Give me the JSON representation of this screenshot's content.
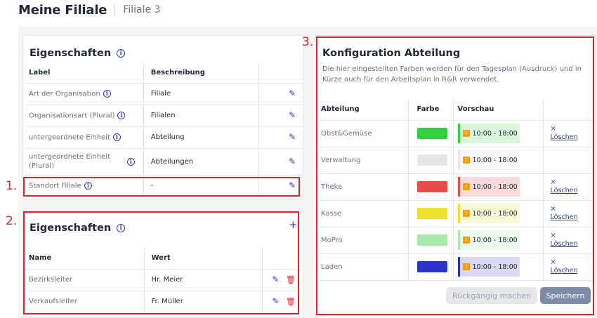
{
  "header": {
    "title": "Meine Filiale",
    "subtitle": "Filiale 3"
  },
  "annotations": {
    "label1": "1.",
    "label2": "2.",
    "label3": "3."
  },
  "properties": {
    "title": "Eigenschaften",
    "col_label": "Label",
    "col_desc": "Beschreibung",
    "rows": [
      {
        "label": "Art der Organisation",
        "value": "Filiale"
      },
      {
        "label": "Organisationsart (Plural)",
        "value": "Filialen"
      },
      {
        "label": "untergeordnete Einheit",
        "value": "Abteilung"
      },
      {
        "label": "untergeordnete Einheit (Plural)",
        "value": "Abteilungen"
      },
      {
        "label": "Standort Filiale",
        "value": "-"
      }
    ]
  },
  "custom_properties": {
    "title": "Eigenschaften",
    "add_label": "+",
    "col_name": "Name",
    "col_value": "Wert",
    "rows": [
      {
        "name": "Bezirksleiter",
        "value": "Hr. Meier"
      },
      {
        "name": "Verkaufsleiter",
        "value": "Fr. Müller"
      }
    ]
  },
  "department_config": {
    "title": "Konfiguration Abteilung",
    "description": "Die hier eingestellten Farben werden für den Tagesplan (Ausdruck) und in Kürze auch für den Arbeitsplan in R&R verwendet.",
    "col_dept": "Abteilung",
    "col_color": "Farbe",
    "col_preview": "Vorschau",
    "delete_x": "×",
    "delete_label": "Löschen",
    "rows": [
      {
        "name": "Obst&Gemüse",
        "color": "#33d13f",
        "preview_bg": "#d9f5dc",
        "time": "10:00 - 18:00",
        "deletable": true
      },
      {
        "name": "Verwaltung",
        "color": "#e6e6e6",
        "preview_bg": "#f7f7f7",
        "time": "10:00 - 18:00",
        "deletable": false
      },
      {
        "name": "Theke",
        "color": "#ea4a4a",
        "preview_bg": "#fbdada",
        "time": "10:00 - 18:00",
        "deletable": true
      },
      {
        "name": "Kasse",
        "color": "#ece134",
        "preview_bg": "#fbf8d4",
        "time": "10:00 - 18:00",
        "deletable": true
      },
      {
        "name": "MoPro",
        "color": "#a8eaab",
        "preview_bg": "#eef9ee",
        "time": "10:00 - 18:00",
        "deletable": true
      },
      {
        "name": "Laden",
        "color": "#2c33c8",
        "preview_bg": "#d8daf4",
        "time": "10:00 - 18:00",
        "deletable": true
      }
    ],
    "undo_label": "Rückgängig machen",
    "save_label": "Speichern"
  },
  "icons": {
    "info": "info-icon",
    "edit": "pencil-icon",
    "delete": "trash-icon",
    "warning": "warning-icon"
  }
}
